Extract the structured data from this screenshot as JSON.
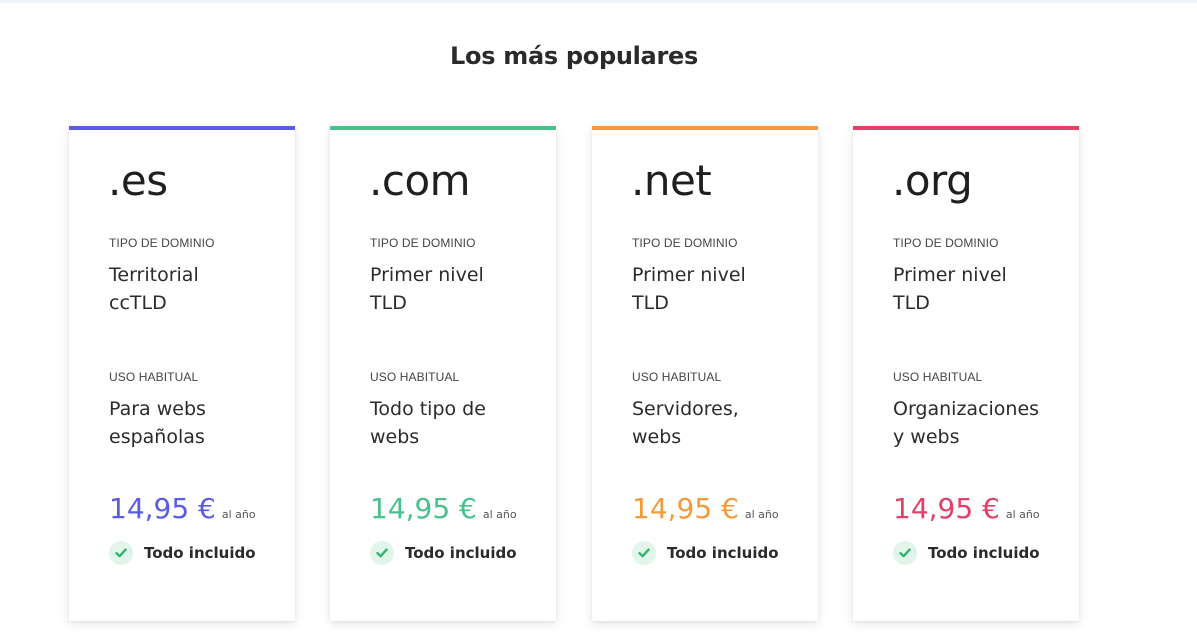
{
  "section": {
    "title": "Los más populares"
  },
  "cards": [
    {
      "extension": ".es",
      "accent_color": "#5a5ce6",
      "type_label": "TIPO DE DOMINIO",
      "type_line1": "Territorial",
      "type_line2": "ccTLD",
      "usage_label": "USO HABITUAL",
      "usage_line1": "Para webs",
      "usage_line2": "españolas",
      "price": "14,95 €",
      "period": "al año",
      "included_text": "Todo incluido",
      "icon": "check-circle-icon"
    },
    {
      "extension": ".com",
      "accent_color": "#48c18d",
      "type_label": "TIPO DE DOMINIO",
      "type_line1": "Primer nivel",
      "type_line2": "TLD",
      "usage_label": "USO HABITUAL",
      "usage_line1": "Todo tipo de",
      "usage_line2": "webs",
      "price": "14,95 €",
      "period": "al año",
      "included_text": "Todo incluido",
      "icon": "check-circle-icon"
    },
    {
      "extension": ".net",
      "accent_color": "#f59a3c",
      "type_label": "TIPO DE DOMINIO",
      "type_line1": "Primer nivel",
      "type_line2": "TLD",
      "usage_label": "USO HABITUAL",
      "usage_line1": "Servidores,",
      "usage_line2": "webs",
      "price": "14,95 €",
      "period": "al año",
      "included_text": "Todo incluido",
      "icon": "check-circle-icon"
    },
    {
      "extension": ".org",
      "accent_color": "#e43f66",
      "type_label": "TIPO DE DOMINIO",
      "type_line1": "Primer nivel",
      "type_line2": "TLD",
      "usage_label": "USO HABITUAL",
      "usage_line1": "Organizaciones",
      "usage_line2": "y webs",
      "price": "14,95 €",
      "period": "al año",
      "included_text": "Todo incluido",
      "icon": "check-circle-icon"
    }
  ],
  "check_color": "#2fb56f"
}
